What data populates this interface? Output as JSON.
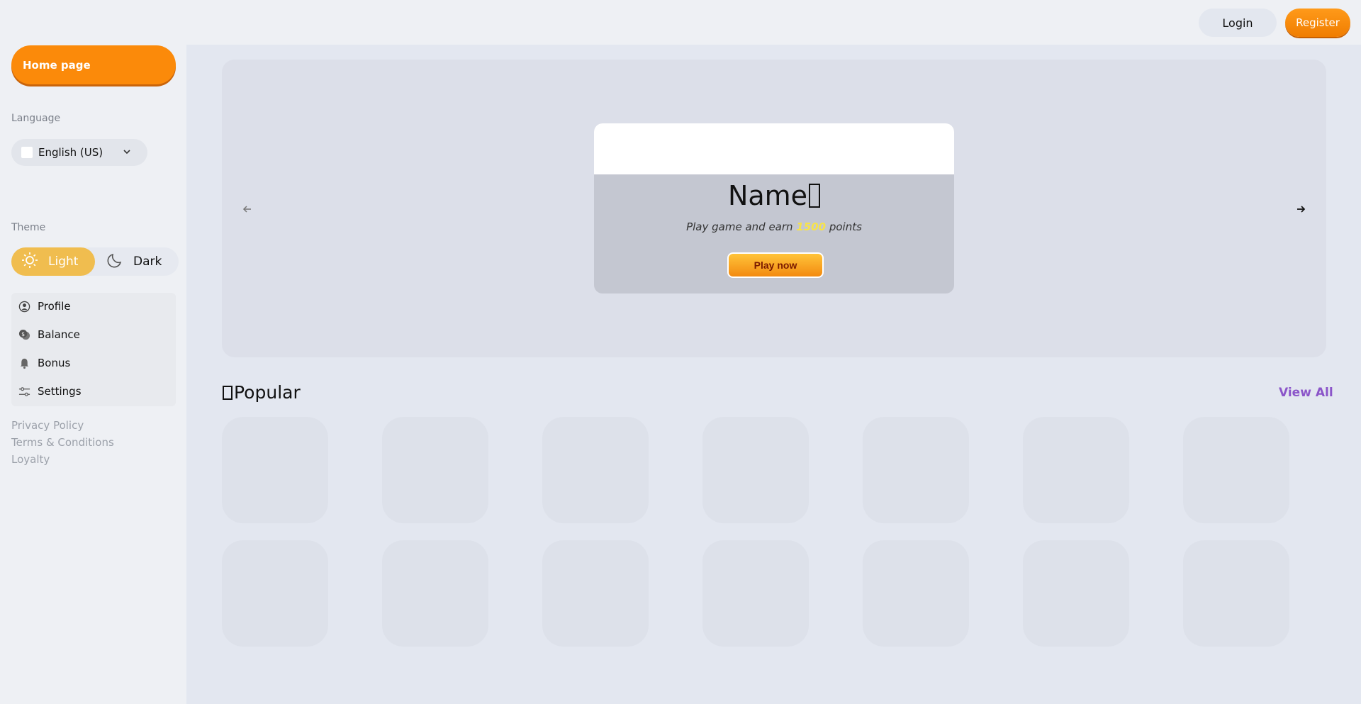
{
  "topbar": {
    "login_label": "Login",
    "register_label": "Register"
  },
  "sidebar": {
    "home_label": "Home page",
    "language_label": "Language",
    "language_value": "English (US)",
    "theme_label": "Theme",
    "theme_light": "Light",
    "theme_dark": "Dark",
    "menu": [
      {
        "label": "Profile",
        "icon": "user-circle-icon"
      },
      {
        "label": "Balance",
        "icon": "coins-icon"
      },
      {
        "label": "Bonus",
        "icon": "bell-icon"
      },
      {
        "label": "Settings",
        "icon": "sliders-icon"
      }
    ],
    "footer_links": [
      "Privacy Policy",
      "Terms & Conditions",
      "Loyalty"
    ]
  },
  "hero": {
    "title": "Name",
    "sub_prefix": "Play game and earn ",
    "points": "1500",
    "sub_suffix": " points",
    "play_label": "Play now"
  },
  "popular": {
    "title": "Popular",
    "view_all": "View All"
  },
  "colors": {
    "accent": "#fb8a0a",
    "theme_light": "#f0bd4f",
    "link_purple": "#8b55c9"
  }
}
